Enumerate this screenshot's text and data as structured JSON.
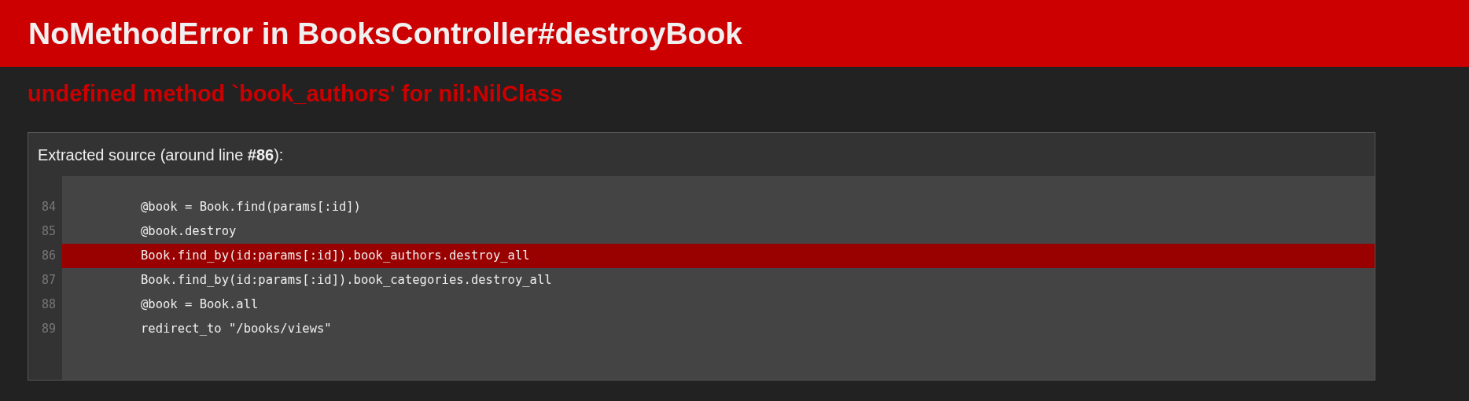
{
  "header": {
    "title": "NoMethodError in BooksController#destroyBook"
  },
  "message": "undefined method `book_authors' for nil:NilClass",
  "source": {
    "title": "Extracted source (around line **#86**):",
    "lines": [
      {
        "number": "84",
        "code": "@book = Book.find(params[:id])",
        "selected": false
      },
      {
        "number": "85",
        "code": "@book.destroy",
        "selected": false
      },
      {
        "number": "86",
        "code": "Book.find_by(id:params[:id]).book_authors.destroy_all",
        "selected": true
      },
      {
        "number": "87",
        "code": "Book.find_by(id:params[:id]).book_categories.destroy_all",
        "selected": false
      },
      {
        "number": "88",
        "code": "@book = Book.all",
        "selected": false
      },
      {
        "number": "89",
        "code": "redirect_to \"/books/views\"",
        "selected": false
      }
    ]
  }
}
